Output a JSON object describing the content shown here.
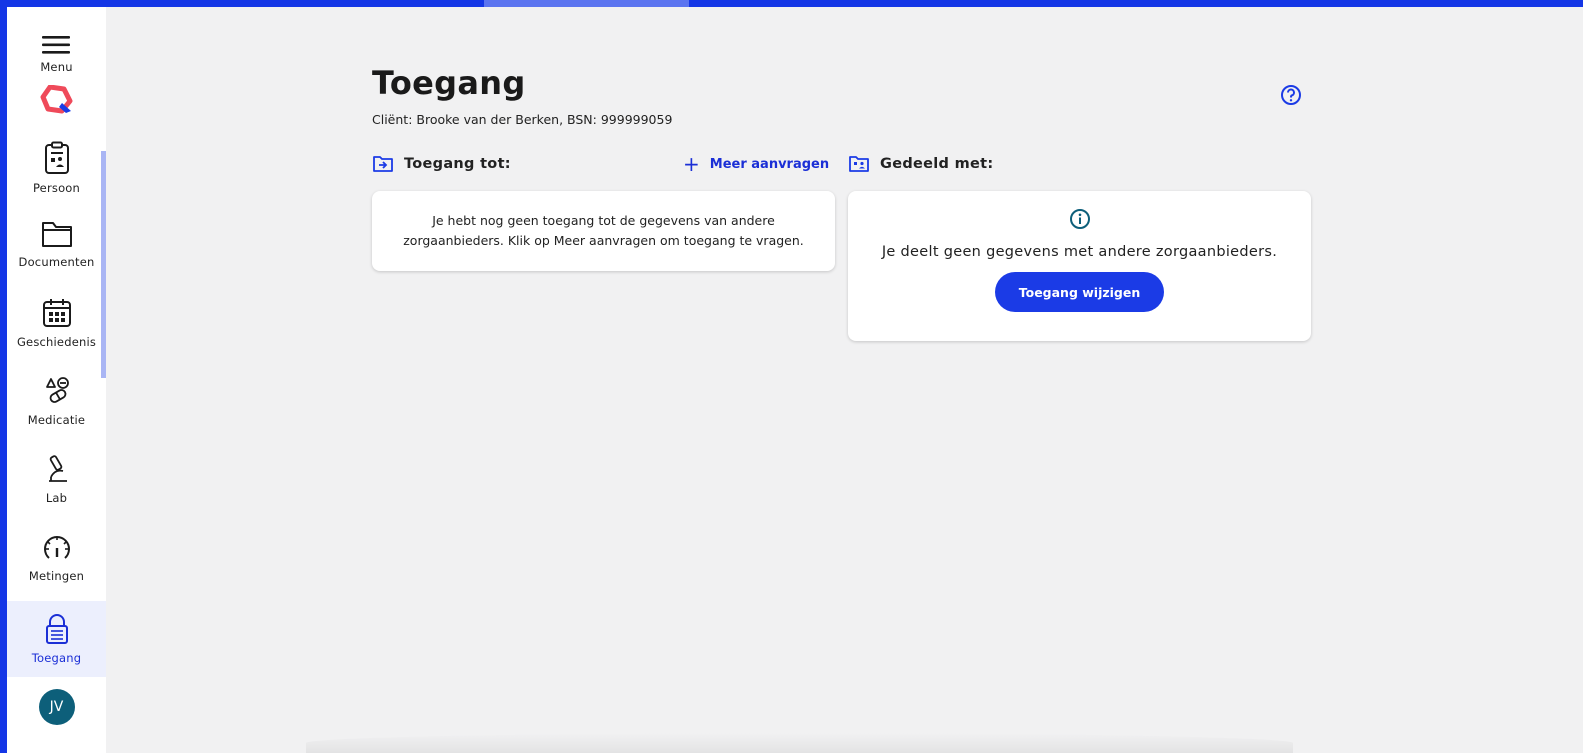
{
  "sidebar": {
    "menu_label": "Menu",
    "items": [
      {
        "label": "Persoon",
        "icon": "person-card-icon"
      },
      {
        "label": "Documenten",
        "icon": "folder-icon"
      },
      {
        "label": "Geschiedenis",
        "icon": "calendar-icon"
      },
      {
        "label": "Medicatie",
        "icon": "medication-icon"
      },
      {
        "label": "Lab",
        "icon": "microscope-icon"
      },
      {
        "label": "Metingen",
        "icon": "gauge-icon"
      },
      {
        "label": "Toegang",
        "icon": "lock-icon",
        "active": true
      }
    ],
    "avatar_initials": "JV"
  },
  "main": {
    "title": "Toegang",
    "client_line": "Cliënt: Brooke van der Berken, BSN: 999999059",
    "access_to": {
      "heading": "Toegang tot:",
      "more_link": "Meer aanvragen",
      "empty_text": "Je hebt nog geen toegang tot de gegevens van andere zorgaanbieders. Klik op Meer aanvragen om toegang te vragen."
    },
    "shared_with": {
      "heading": "Gedeeld met:",
      "message": "Je deelt geen gegevens met andere zorgaanbieders.",
      "button_label": "Toegang wijzigen"
    }
  },
  "colors": {
    "brand_blue": "#1b3be6",
    "background": "#f1f1f2",
    "avatar": "#0d5f7a",
    "info_icon": "#0d5f7a"
  }
}
